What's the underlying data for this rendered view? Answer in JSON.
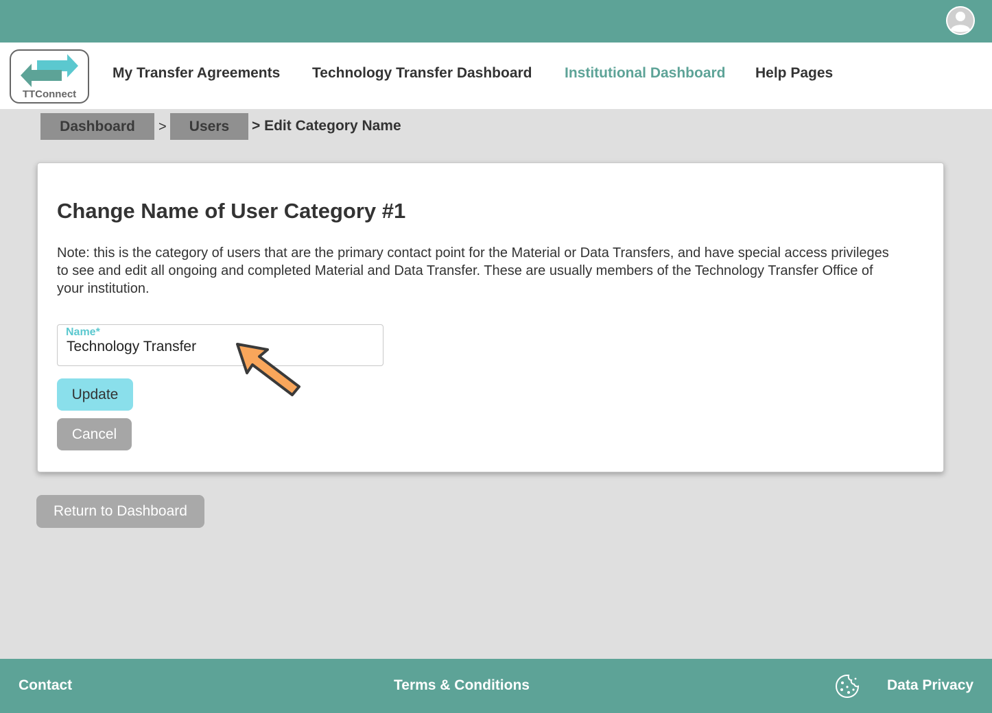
{
  "topbar": {
    "avatar_icon": "user-avatar-icon"
  },
  "header": {
    "logo_text": "TTConnect",
    "nav": [
      {
        "label": "My Transfer Agreements"
      },
      {
        "label": "Technology Transfer Dashboard"
      },
      {
        "label": "Institutional Dashboard",
        "active": true
      },
      {
        "label": "Help Pages"
      }
    ]
  },
  "breadcrumb": {
    "items": [
      "Dashboard",
      "Users"
    ],
    "separator": ">",
    "current": "> Edit Category Name"
  },
  "card": {
    "title": "Change Name of User Category #1",
    "note": "Note: this is the category of users that are the primary contact point for the Material or Data Transfers, and have special access privileges to see and edit all ongoing and completed Material and Data Transfer. These are usually members of the Technology Transfer Office of your institution.",
    "name_field": {
      "label": "Name*",
      "value": "Technology Transfer"
    },
    "update_label": "Update",
    "cancel_label": "Cancel"
  },
  "return_label": "Return to Dashboard",
  "footer": {
    "contact": "Contact",
    "terms": "Terms & Conditions",
    "privacy": "Data Privacy",
    "cookie_icon": "cookie-icon"
  },
  "colors": {
    "brand_teal": "#5da397",
    "accent_cyan": "#8adfeb",
    "label_cyan": "#5bc8cf",
    "annotation_orange": "#f9a65b"
  }
}
